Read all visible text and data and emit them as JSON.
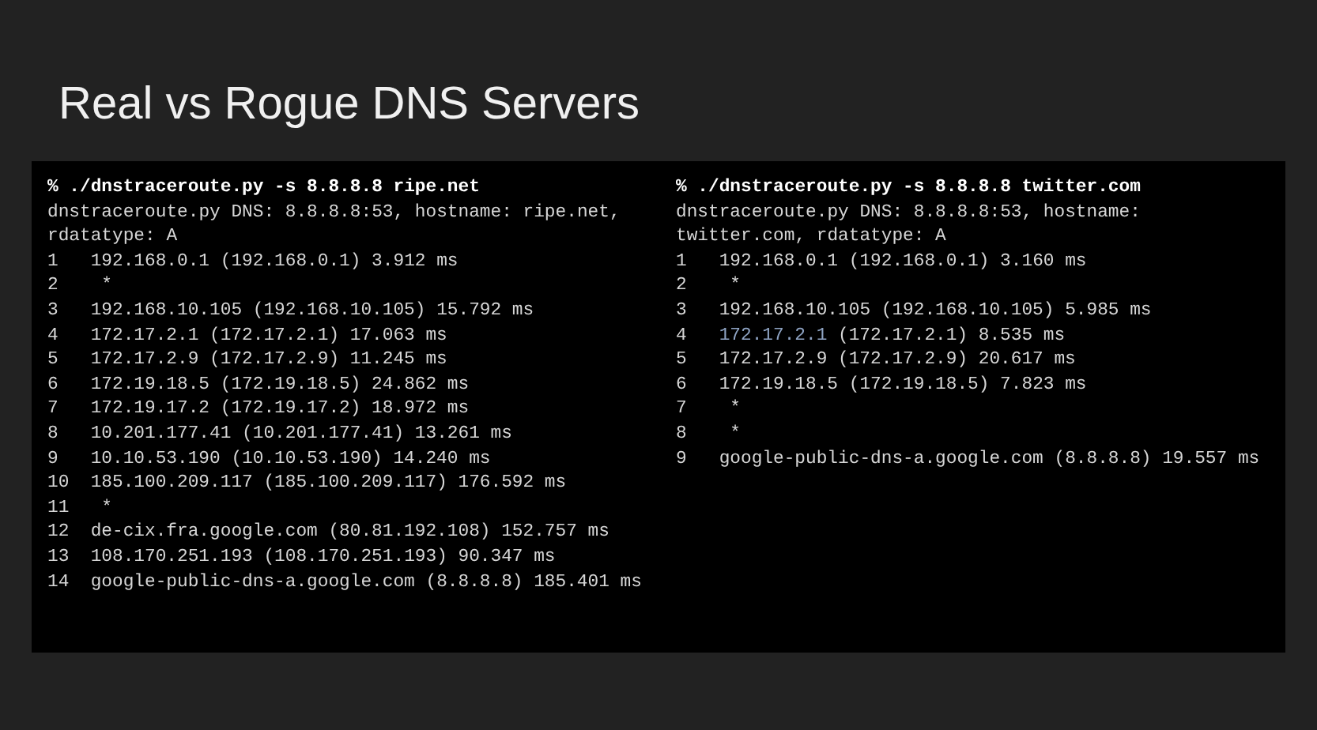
{
  "title": "Real vs Rogue DNS Servers",
  "terminals": [
    {
      "command": "% ./dnstraceroute.py -s 8.8.8.8 ripe.net",
      "info_lines": [
        "dnstraceroute.py DNS: 8.8.8.8:53, hostname: ripe.net,",
        "rdatatype: A"
      ],
      "hops": [
        {
          "hop": "1",
          "address": "192.168.0.1",
          "detail": "(192.168.0.1) 3.912 ms",
          "highlighted": false
        },
        {
          "hop": "2",
          "address": "*",
          "highlighted": false
        },
        {
          "hop": "3",
          "address": "192.168.10.105",
          "detail": "(192.168.10.105) 15.792 ms",
          "highlighted": false
        },
        {
          "hop": "4",
          "address": "172.17.2.1",
          "detail": "(172.17.2.1) 17.063 ms",
          "highlighted": false
        },
        {
          "hop": "5",
          "address": "172.17.2.9",
          "detail": "(172.17.2.9) 11.245 ms",
          "highlighted": false
        },
        {
          "hop": "6",
          "address": "172.19.18.5",
          "detail": "(172.19.18.5) 24.862 ms",
          "highlighted": false
        },
        {
          "hop": "7",
          "address": "172.19.17.2",
          "detail": "(172.19.17.2) 18.972 ms",
          "highlighted": false
        },
        {
          "hop": "8",
          "address": "10.201.177.41",
          "detail": "(10.201.177.41) 13.261 ms",
          "highlighted": false
        },
        {
          "hop": "9",
          "address": "10.10.53.190",
          "detail": "(10.10.53.190) 14.240 ms",
          "highlighted": false
        },
        {
          "hop": "10",
          "address": "185.100.209.117",
          "detail": "(185.100.209.117) 176.592 ms",
          "highlighted": false
        },
        {
          "hop": "11",
          "address": "*",
          "highlighted": false
        },
        {
          "hop": "12",
          "address": "de-cix.fra.google.com",
          "detail": "(80.81.192.108) 152.757 ms",
          "highlighted": false
        },
        {
          "hop": "13",
          "address": "108.170.251.193",
          "detail": "(108.170.251.193) 90.347 ms",
          "highlighted": false
        },
        {
          "hop": "14",
          "address": "google-public-dns-a.google.com",
          "detail": "(8.8.8.8) 185.401 ms",
          "highlighted": false
        }
      ]
    },
    {
      "command": "% ./dnstraceroute.py -s 8.8.8.8 twitter.com",
      "info_lines": [
        "dnstraceroute.py DNS: 8.8.8.8:53, hostname:",
        "twitter.com, rdatatype: A"
      ],
      "hops": [
        {
          "hop": "1",
          "address": "192.168.0.1",
          "detail": "(192.168.0.1) 3.160 ms",
          "highlighted": false
        },
        {
          "hop": "2",
          "address": "*",
          "highlighted": false
        },
        {
          "hop": "3",
          "address": "192.168.10.105",
          "detail": "(192.168.10.105) 5.985 ms",
          "highlighted": false
        },
        {
          "hop": "4",
          "address": "172.17.2.1",
          "detail": "(172.17.2.1) 8.535 ms",
          "highlighted": true
        },
        {
          "hop": "5",
          "address": "172.17.2.9",
          "detail": "(172.17.2.9) 20.617 ms",
          "highlighted": false
        },
        {
          "hop": "6",
          "address": "172.19.18.5",
          "detail": "(172.19.18.5) 7.823 ms",
          "highlighted": false
        },
        {
          "hop": "7",
          "address": "*",
          "highlighted": false
        },
        {
          "hop": "8",
          "address": "*",
          "highlighted": false
        },
        {
          "hop": "9",
          "address": "google-public-dns-a.google.com",
          "detail": "(8.8.8.8) 19.557 ms",
          "highlighted": false
        }
      ]
    }
  ]
}
